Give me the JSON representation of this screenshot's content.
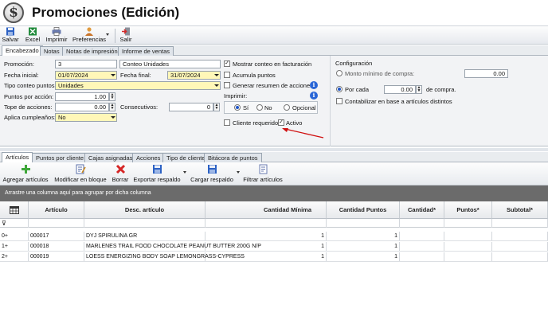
{
  "window": {
    "title": "Promociones (Edición)",
    "logo_glyph": "$"
  },
  "toolbar": {
    "items": [
      {
        "label": "Salvar",
        "icon": "save-icon"
      },
      {
        "label": "Excel",
        "icon": "excel-icon"
      },
      {
        "label": "Imprimir",
        "icon": "printer-icon"
      },
      {
        "label": "Preferencias",
        "icon": "user-settings-icon"
      },
      {
        "label": "Salir",
        "icon": "exit-icon"
      }
    ]
  },
  "tabs_top": [
    "Encabezado",
    "Notas",
    "Notas de impresión",
    "Informe de ventas"
  ],
  "form": {
    "promocion_label": "Promoción:",
    "promocion_value": "3",
    "descripcion_value": "Conteo Unidades",
    "fecha_inicial_label": "Fecha inicial:",
    "fecha_inicial_value": "01/07/2024",
    "fecha_final_label": "Fecha final:",
    "fecha_final_value": "31/07/2024",
    "tipo_conteo_label": "Tipo conteo puntos:",
    "tipo_conteo_value": "Unidades",
    "puntos_accion_label": "Puntos por acción:",
    "puntos_accion_value": "1.00",
    "tope_label": "Tope de acciones:",
    "tope_value": "0.00",
    "consecutivos_label": "Consecutivos:",
    "consecutivos_value": "0",
    "cumpleanos_label": "Aplica cumpleaños:",
    "cumpleanos_value": "No",
    "mostrar_conteo": "Mostrar conteo en facturación",
    "acumula_puntos": "Acumula puntos",
    "generar_resumen": "Generar resumen de acciones",
    "imprimir_label": "Imprimir:",
    "imprimir_opts": [
      "Sí",
      "No",
      "Opcional"
    ],
    "cliente_requerido": "Cliente requerido",
    "activo": "Activo",
    "config_label": "Configuración",
    "monto_label": "Monto mínimo de compra:",
    "monto_value": "0.00",
    "por_cada_label": "Por cada",
    "por_cada_value": "0.00",
    "de_compra": "de compra.",
    "contabilizar": "Contabilizar en base a artículos distintos"
  },
  "tabs_bottom": [
    "Artículos",
    "Puntos por cliente",
    "Cajas asignadas",
    "Acciones",
    "Tipo de cliente",
    "Bitácora de puntos"
  ],
  "toolbar2": {
    "items": [
      {
        "label": "Agregar artículos",
        "icon": "add-icon"
      },
      {
        "label": "Modificar en bloque",
        "icon": "edit-block-icon"
      },
      {
        "label": "Borrar",
        "icon": "delete-icon"
      },
      {
        "label": "Exportar respaldo",
        "icon": "export-icon"
      },
      {
        "label": "Cargar respaldo",
        "icon": "load-icon"
      },
      {
        "label": "Filtrar artículos",
        "icon": "filter-icon"
      }
    ]
  },
  "groupbar": "Arrastre una columna aquí para agrupar por dicha columna",
  "grid": {
    "columns": [
      "Artículo",
      "Desc. artículo",
      "Cantidad Mínima",
      "Cantidad Puntos",
      "Cantidad*",
      "Puntos*",
      "Subtotal*"
    ],
    "rows": [
      {
        "num": "0+",
        "articulo": "000017",
        "desc": "DYJ SPIRULINA GR",
        "cant_min": "1",
        "cant_puntos": "1"
      },
      {
        "num": "1+",
        "articulo": "000018",
        "desc": "MARLENES TRAIL FOOD CHOCOLATE PEANUT BUTTER 200G N/P",
        "cant_min": "1",
        "cant_puntos": "1"
      },
      {
        "num": "2+",
        "articulo": "000019",
        "desc": "LOESS ENERGIZING BODY SOAP LEMONGRASS-CYPRESS",
        "cant_min": "1",
        "cant_puntos": "1"
      }
    ]
  },
  "colors": {
    "field_yellow": "#fff7b8",
    "groupbar": "#6b6b6b",
    "accent_blue": "#2a66d6",
    "annotation_red": "#d01010"
  }
}
